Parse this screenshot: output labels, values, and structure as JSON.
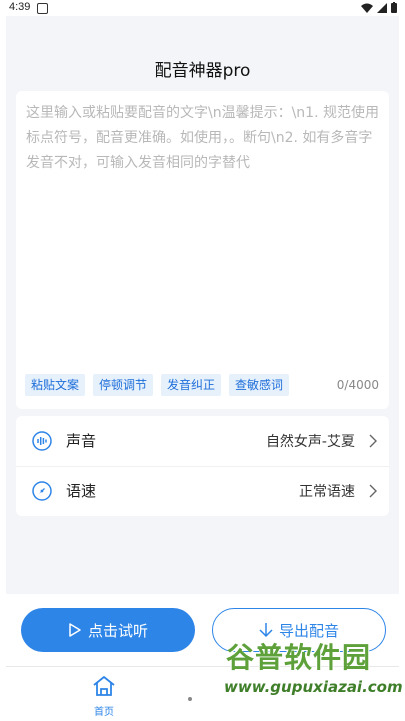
{
  "status_bar": {
    "time": "4:39"
  },
  "header": {
    "title": "配音神器pro"
  },
  "editor": {
    "placeholder": "这里输入或粘贴要配音的文字\\n温馨提示：\\n1. 规范使用标点符号，配音更准确。如使用，。断句\\n2. 如有多音字发音不对，可输入发音相同的字替代",
    "tools": [
      "粘贴文案",
      "停顿调节",
      "发音纠正",
      "查敏感词"
    ],
    "char_count": "0/4000"
  },
  "settings": {
    "voice": {
      "label": "声音",
      "value": "自然女声-艾夏"
    },
    "speed": {
      "label": "语速",
      "value": "正常语速"
    }
  },
  "actions": {
    "preview_label": "点击试听",
    "export_label": "导出配音"
  },
  "tab_bar": {
    "home_label": "首页"
  },
  "watermark": {
    "text": "谷普软件园",
    "url": "www.gupuxiazai.com"
  },
  "colors": {
    "accent": "#2e85e8",
    "chip_bg": "#e7f1fc",
    "background": "#f3f5f8"
  }
}
